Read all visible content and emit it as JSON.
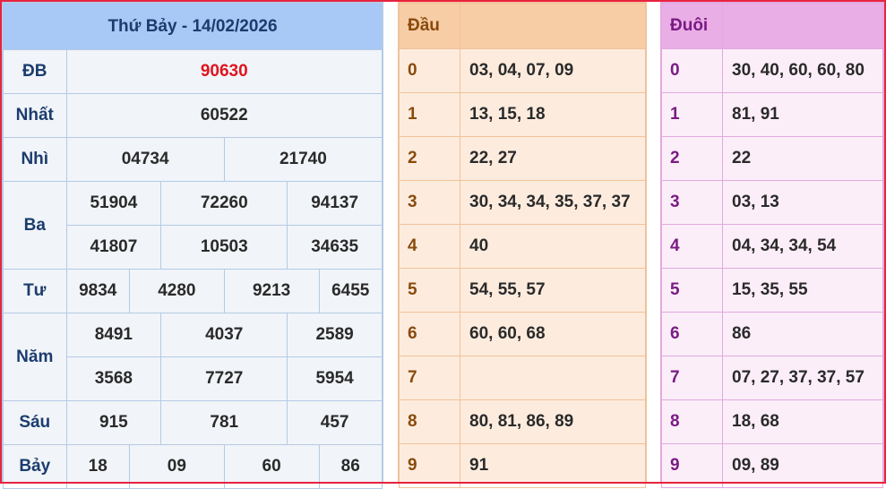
{
  "results": {
    "title": "Thứ Bảy - 14/02/2026",
    "prizes": [
      {
        "label": "ĐB",
        "rows": [
          [
            "90630"
          ]
        ]
      },
      {
        "label": "Nhất",
        "rows": [
          [
            "60522"
          ]
        ]
      },
      {
        "label": "Nhì",
        "rows": [
          [
            "04734",
            "21740"
          ]
        ]
      },
      {
        "label": "Ba",
        "rows": [
          [
            "51904",
            "72260",
            "94137"
          ],
          [
            "41807",
            "10503",
            "34635"
          ]
        ]
      },
      {
        "label": "Tư",
        "rows": [
          [
            "9834",
            "4280",
            "9213",
            "6455"
          ]
        ]
      },
      {
        "label": "Năm",
        "rows": [
          [
            "8491",
            "4037",
            "2589"
          ],
          [
            "3568",
            "7727",
            "5954"
          ]
        ]
      },
      {
        "label": "Sáu",
        "rows": [
          [
            "915",
            "781",
            "457"
          ]
        ]
      },
      {
        "label": "Bảy",
        "rows": [
          [
            "18",
            "09",
            "60",
            "86"
          ]
        ]
      }
    ]
  },
  "dau": {
    "header": "Đầu",
    "rows": [
      {
        "key": "0",
        "values": "03, 04, 07, 09"
      },
      {
        "key": "1",
        "values": "13, 15, 18"
      },
      {
        "key": "2",
        "values": "22, 27"
      },
      {
        "key": "3",
        "values": "30, 34, 34, 35, 37, 37"
      },
      {
        "key": "4",
        "values": "40"
      },
      {
        "key": "5",
        "values": "54, 55, 57"
      },
      {
        "key": "6",
        "values": "60, 60, 68"
      },
      {
        "key": "7",
        "values": ""
      },
      {
        "key": "8",
        "values": "80, 81, 86, 89"
      },
      {
        "key": "9",
        "values": "91"
      }
    ]
  },
  "duoi": {
    "header": "Đuôi",
    "rows": [
      {
        "key": "0",
        "values": "30, 40, 60, 60, 80"
      },
      {
        "key": "1",
        "values": "81, 91"
      },
      {
        "key": "2",
        "values": "22"
      },
      {
        "key": "3",
        "values": "03, 13"
      },
      {
        "key": "4",
        "values": "04, 34, 34, 54"
      },
      {
        "key": "5",
        "values": "15, 35, 55"
      },
      {
        "key": "6",
        "values": "86"
      },
      {
        "key": "7",
        "values": "07, 27, 37, 37, 57"
      },
      {
        "key": "8",
        "values": "18, 68"
      },
      {
        "key": "9",
        "values": "09, 89"
      }
    ]
  },
  "colors": {
    "frame_border": "#e8233f",
    "special_prize": "#e0141e",
    "results_header": "#a8c8f5",
    "dau_header": "#f7cda6",
    "duoi_header": "#e9aee6"
  }
}
